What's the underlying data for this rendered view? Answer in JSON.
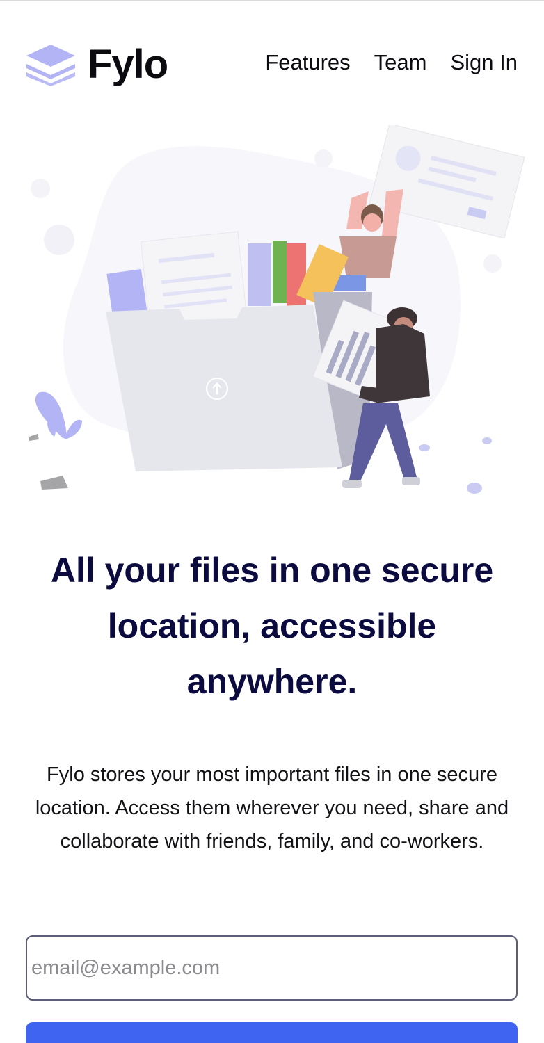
{
  "brand": {
    "name": "Fylo",
    "logo_icon": "stacked-layers-icon",
    "logo_color": "#b3b4f5"
  },
  "nav": {
    "items": [
      {
        "label": "Features"
      },
      {
        "label": "Team"
      },
      {
        "label": "Sign In"
      }
    ]
  },
  "hero": {
    "illustration": "illustration-people-uploading-files",
    "headline": "All your files in one secure location, accessible anywhere.",
    "description": "Fylo stores your most important files in one secure location. Access them wherever you need, share and collaborate with friends, family, and co-workers."
  },
  "signup": {
    "email_placeholder": "email@example.com",
    "email_value": "",
    "cta_label": "",
    "cta_color": "#3f64f2"
  },
  "colors": {
    "headline": "#0b0b3f",
    "accent": "#3f64f2",
    "illustration_purple": "#b3b4f5",
    "folder_gray": "#e6e7ec"
  }
}
